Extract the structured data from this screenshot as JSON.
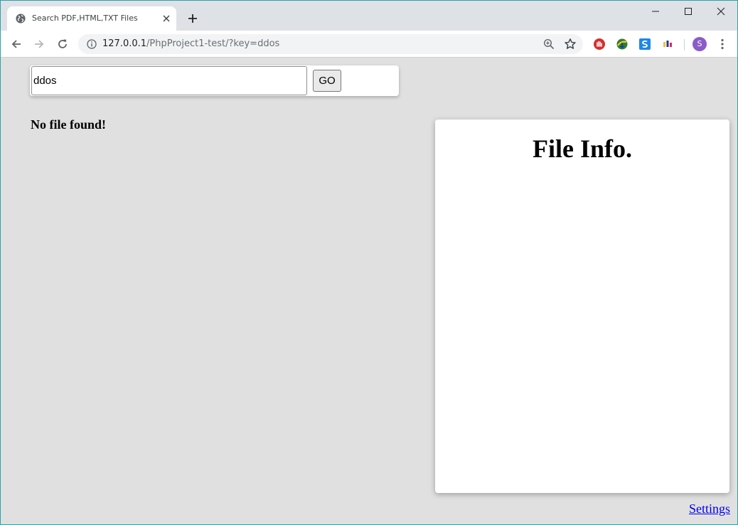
{
  "browser": {
    "tab": {
      "title": "Search PDF,HTML,TXT Files",
      "favicon": "globe-icon"
    },
    "address": {
      "host": "127.0.0.1",
      "path": "/PhpProject1-test/?key=ddos"
    },
    "profile_initial": "S",
    "colors": {
      "frame": "#dee1e6",
      "window_border": "#2aa3a9",
      "profile": "#8b5cc7"
    }
  },
  "page": {
    "search": {
      "value": "ddos",
      "button_label": "GO"
    },
    "message": "No file found!",
    "info_panel": {
      "title": "File Info."
    },
    "settings_link": "Settings",
    "colors": {
      "background": "#e0e0e0",
      "link": "#0000ee"
    }
  }
}
